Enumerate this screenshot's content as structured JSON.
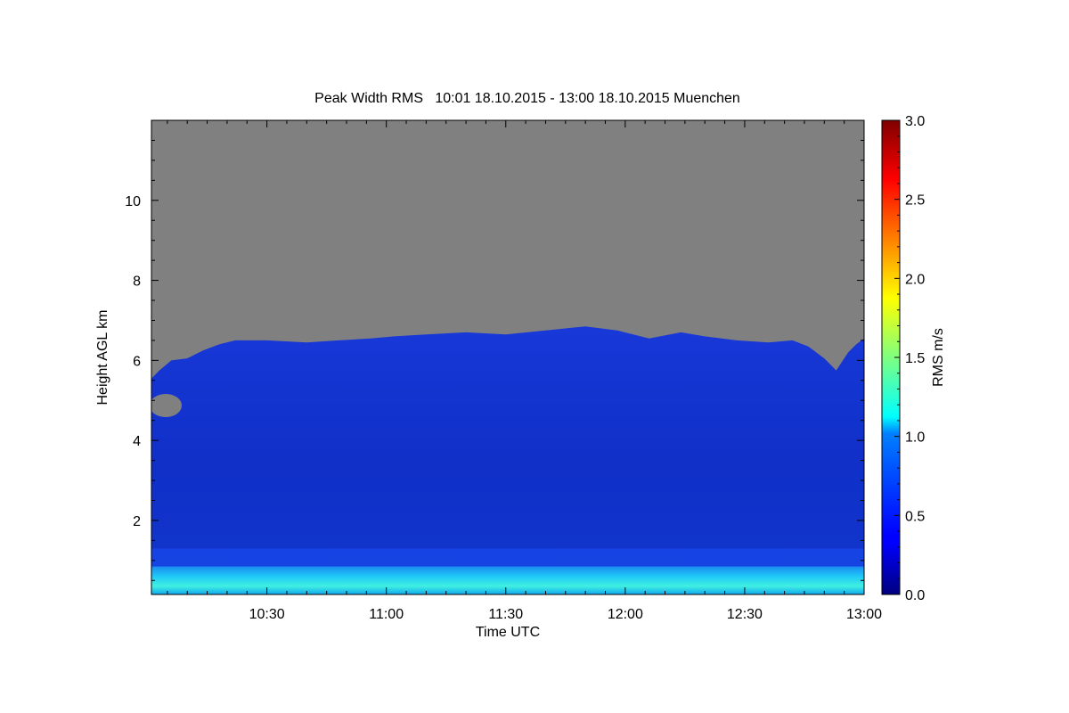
{
  "chart_data": {
    "type": "heatmap",
    "title": "Peak Width RMS   10:01 18.10.2015 - 13:00 18.10.2015 Muenchen",
    "xlabel": "Time UTC",
    "ylabel": "Height AGL km",
    "colorbar_label": "RMS m/s",
    "x_ticks": [
      {
        "value": 30,
        "label": "10:30"
      },
      {
        "value": 60,
        "label": "11:00"
      },
      {
        "value": 90,
        "label": "11:30"
      },
      {
        "value": 120,
        "label": "12:00"
      },
      {
        "value": 150,
        "label": "12:30"
      },
      {
        "value": 180,
        "label": "13:00"
      }
    ],
    "x_range_minutes_after_10_00": [
      1,
      180
    ],
    "y_ticks": [
      2,
      4,
      6,
      8,
      10
    ],
    "ylim": [
      0.15,
      12
    ],
    "colorbar_ticks": [
      "0.0",
      "0.5",
      "1.0",
      "1.5",
      "2.0",
      "2.5",
      "3.0"
    ],
    "colorbar_range": [
      0.0,
      3.0
    ],
    "colormap": "jet",
    "no_data_color": "#808080",
    "data_top_height_km": [
      [
        1,
        5.55
      ],
      [
        3,
        5.75
      ],
      [
        6,
        6.0
      ],
      [
        10,
        6.05
      ],
      [
        14,
        6.25
      ],
      [
        18,
        6.4
      ],
      [
        22,
        6.5
      ],
      [
        30,
        6.5
      ],
      [
        40,
        6.45
      ],
      [
        48,
        6.5
      ],
      [
        56,
        6.55
      ],
      [
        62,
        6.6
      ],
      [
        70,
        6.65
      ],
      [
        80,
        6.7
      ],
      [
        90,
        6.65
      ],
      [
        100,
        6.75
      ],
      [
        110,
        6.85
      ],
      [
        118,
        6.75
      ],
      [
        126,
        6.55
      ],
      [
        134,
        6.7
      ],
      [
        140,
        6.6
      ],
      [
        148,
        6.5
      ],
      [
        156,
        6.45
      ],
      [
        162,
        6.5
      ],
      [
        166,
        6.35
      ],
      [
        170,
        6.05
      ],
      [
        173,
        5.75
      ],
      [
        176,
        6.2
      ],
      [
        178,
        6.4
      ],
      [
        180,
        6.55
      ]
    ],
    "layers": [
      {
        "height_km": [
          0.15,
          0.85
        ],
        "rms_ms": 1.0
      },
      {
        "height_km": [
          0.85,
          1.3
        ],
        "rms_ms": 0.45
      },
      {
        "height_km": [
          1.3,
          4.5
        ],
        "rms_ms": 0.3
      },
      {
        "height_km": [
          4.5,
          6.5
        ],
        "rms_ms": 0.35
      }
    ]
  }
}
